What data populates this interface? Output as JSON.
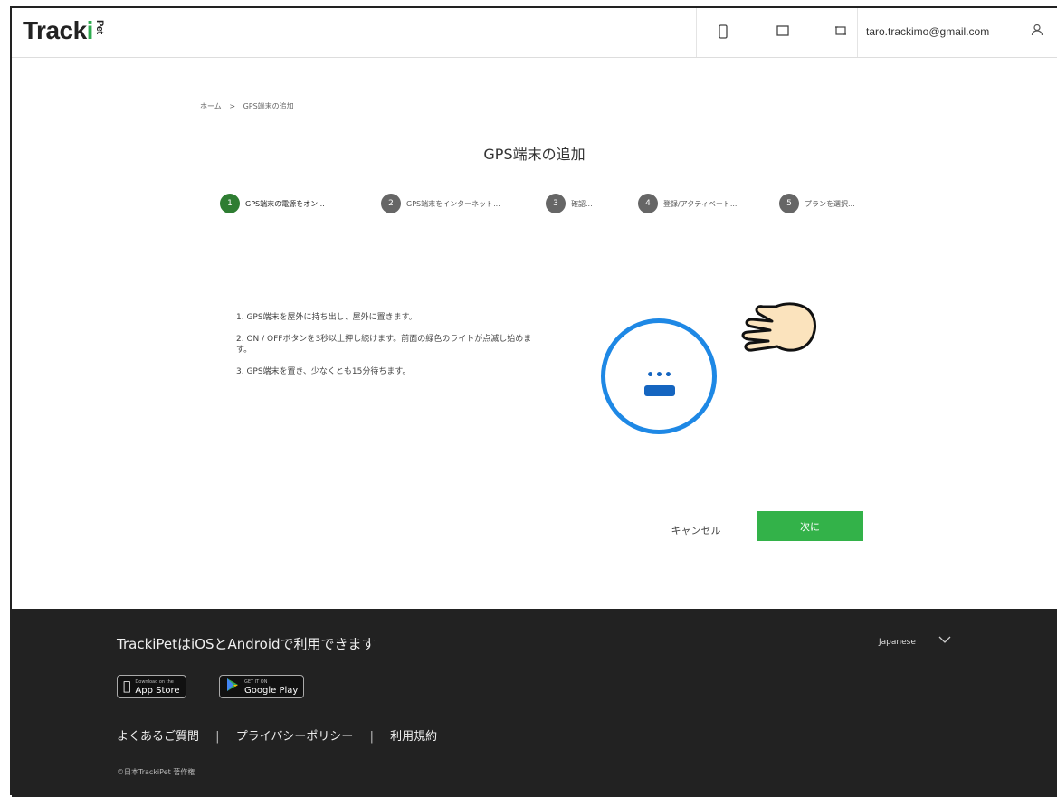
{
  "header": {
    "logo_main": "Track",
    "logo_dot": "i",
    "logo_sub": "Pet",
    "email": "taro.trackimo@gmail.com"
  },
  "breadcrumb": [
    "ホーム",
    ">",
    "GPS端末の追加"
  ],
  "title": "GPS端末の追加",
  "steps": [
    {
      "num": "1",
      "label": "GPS端末の電源をオン..."
    },
    {
      "num": "2",
      "label": "GPS端末をインターネット..."
    },
    {
      "num": "3",
      "label": "確認..."
    },
    {
      "num": "4",
      "label": "登録/アクティベート..."
    },
    {
      "num": "5",
      "label": "プランを選択..."
    }
  ],
  "instructions": [
    "1. GPS端末を屋外に持ち出し、屋外に置きます。",
    "2. ON / OFFボタンを3秒以上押し続けます。前面の緑色のライトが点滅し始めます。",
    "3. GPS端末を置き、少なくとも15分待ちます。"
  ],
  "device": {
    "led_text": "•••"
  },
  "buttons": {
    "cancel": "キャンセル",
    "next": "次に"
  },
  "footer": {
    "title": "TrackiPetはiOSとAndroidで利用できます",
    "language": "Japanese",
    "app_store_small": "Download on the",
    "app_store": "App Store",
    "google_play_small": "GET IT ON",
    "google_play": "Google Play",
    "links": [
      "よくあるご質問",
      "プライバシーポリシー",
      "利用規約"
    ],
    "copyright": "©日本TrackiPet 著作権"
  },
  "colors": {
    "accent_green": "#33b249",
    "step_active": "#2e7d32",
    "device_blue": "#1e88e5",
    "footer_bg": "#222222"
  }
}
